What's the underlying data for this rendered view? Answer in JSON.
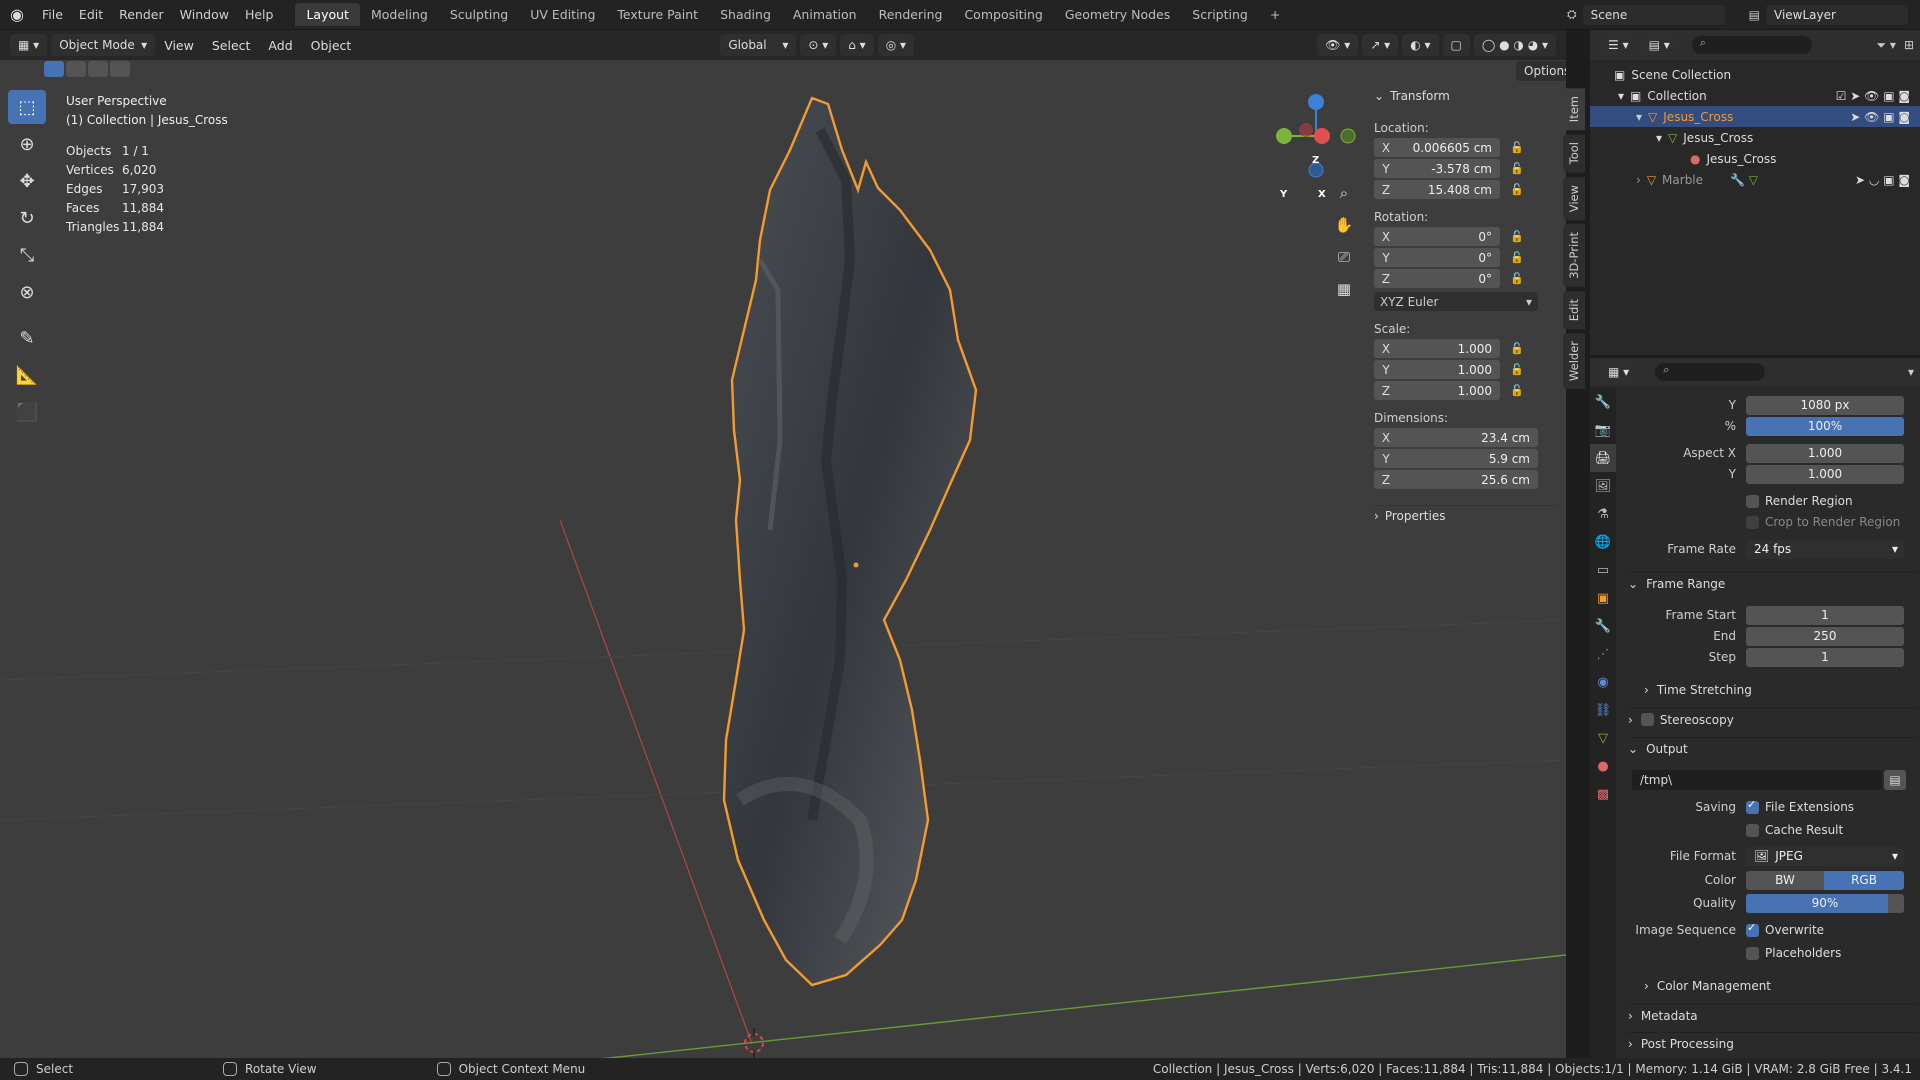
{
  "topbar": {
    "menus": [
      "File",
      "Edit",
      "Render",
      "Window",
      "Help"
    ],
    "workspaces": [
      "Layout",
      "Modeling",
      "Sculpting",
      "UV Editing",
      "Texture Paint",
      "Shading",
      "Animation",
      "Rendering",
      "Compositing",
      "Geometry Nodes",
      "Scripting"
    ],
    "active_workspace": "Layout",
    "add_tab": "+",
    "scene": "Scene",
    "view_layer": "ViewLayer"
  },
  "viewport_header": {
    "mode": "Object Mode",
    "menus": [
      "View",
      "Select",
      "Add",
      "Object"
    ],
    "orientation": "Global",
    "options": "Options"
  },
  "overlay_info": {
    "view_name": "User Perspective",
    "collection_line": "(1) Collection | Jesus_Cross",
    "stats": [
      {
        "label": "Objects",
        "value": "1 / 1"
      },
      {
        "label": "Vertices",
        "value": "6,020"
      },
      {
        "label": "Edges",
        "value": "17,903"
      },
      {
        "label": "Faces",
        "value": "11,884"
      },
      {
        "label": "Triangles",
        "value": "11,884"
      }
    ]
  },
  "gizmo": {
    "z": "Z",
    "y": "Y",
    "x": "X"
  },
  "npanel": {
    "transform_header": "Transform",
    "location_label": "Location:",
    "location": [
      {
        "ax": "X",
        "val": "0.006605 cm"
      },
      {
        "ax": "Y",
        "val": "-3.578 cm"
      },
      {
        "ax": "Z",
        "val": "15.408 cm"
      }
    ],
    "rotation_label": "Rotation:",
    "rotation": [
      {
        "ax": "X",
        "val": "0°"
      },
      {
        "ax": "Y",
        "val": "0°"
      },
      {
        "ax": "Z",
        "val": "0°"
      }
    ],
    "rotation_mode": "XYZ Euler",
    "scale_label": "Scale:",
    "scale": [
      {
        "ax": "X",
        "val": "1.000"
      },
      {
        "ax": "Y",
        "val": "1.000"
      },
      {
        "ax": "Z",
        "val": "1.000"
      }
    ],
    "dimensions_label": "Dimensions:",
    "dimensions": [
      {
        "ax": "X",
        "val": "23.4 cm"
      },
      {
        "ax": "Y",
        "val": "5.9 cm"
      },
      {
        "ax": "Z",
        "val": "25.6 cm"
      }
    ],
    "properties_header": "Properties",
    "side_tabs": [
      "Item",
      "Tool",
      "View",
      "3D-Print",
      "Edit",
      "Welder"
    ]
  },
  "outliner": {
    "rows": [
      {
        "label": "Scene Collection",
        "indent": 0
      },
      {
        "label": "Collection",
        "indent": 1
      },
      {
        "label": "Jesus_Cross",
        "indent": 2,
        "selected": true
      },
      {
        "label": "Jesus_Cross",
        "indent": 3
      },
      {
        "label": "Jesus_Cross",
        "indent": 4
      },
      {
        "label": "Marble",
        "indent": 2
      }
    ]
  },
  "properties": {
    "y_res_label": "Y",
    "y_res": "1080 px",
    "pct_label": "%",
    "pct": "100%",
    "aspect_x_label": "Aspect X",
    "aspect_x": "1.000",
    "aspect_y_label": "Y",
    "aspect_y": "1.000",
    "render_region": "Render Region",
    "crop_region": "Crop to Render Region",
    "frame_rate_label": "Frame Rate",
    "frame_rate": "24 fps",
    "frame_range_header": "Frame Range",
    "frame_start_label": "Frame Start",
    "frame_start": "1",
    "end_label": "End",
    "end": "250",
    "step_label": "Step",
    "step": "1",
    "time_stretching": "Time Stretching",
    "stereoscopy": "Stereoscopy",
    "output_header": "Output",
    "output_path": "/tmp\\",
    "saving_label": "Saving",
    "file_extensions": "File Extensions",
    "cache_result": "Cache Result",
    "file_format_label": "File Format",
    "file_format": "JPEG",
    "color_label": "Color",
    "color_bw": "BW",
    "color_rgb": "RGB",
    "quality_label": "Quality",
    "quality": "90%",
    "image_sequence_label": "Image Sequence",
    "overwrite": "Overwrite",
    "placeholders": "Placeholders",
    "color_management": "Color Management",
    "metadata": "Metadata",
    "post_processing": "Post Processing"
  },
  "statusbar": {
    "select": "Select",
    "rotate": "Rotate View",
    "context": "Object Context Menu",
    "info": "Collection | Jesus_Cross | Verts:6,020 | Faces:11,884 | Tris:11,884 | Objects:1/1 | Memory: 1.14 GiB | VRAM: 2.8 GiB Free | 3.4.1"
  },
  "colors": {
    "accent": "#4772b3",
    "selection_outline": "#f59a2f",
    "x_axis": "#e05050",
    "y_axis": "#7bb53a",
    "z_axis": "#3d82d8"
  }
}
